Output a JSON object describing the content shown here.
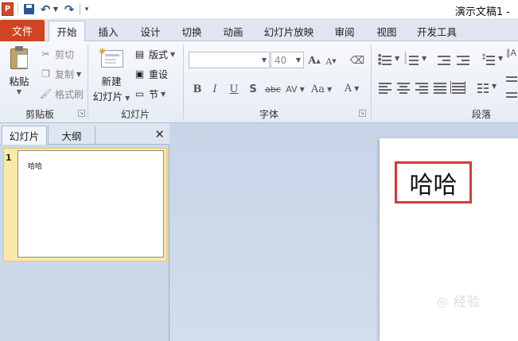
{
  "app": {
    "logo_letter": "P",
    "window_title": "演示文稿1 -"
  },
  "tabs": {
    "file": "文件",
    "items": [
      "开始",
      "插入",
      "设计",
      "切换",
      "动画",
      "幻灯片放映",
      "审阅",
      "视图",
      "开发工具"
    ],
    "active": "开始"
  },
  "ribbon": {
    "clipboard": {
      "paste": "粘贴",
      "cut": "剪切",
      "copy": "复制",
      "format_painter": "格式刷",
      "label": "剪贴板"
    },
    "slides": {
      "new_slide_line1": "新建",
      "new_slide_line2": "幻灯片",
      "layout": "版式",
      "reset": "重设",
      "section": "节",
      "label": "幻灯片"
    },
    "font": {
      "font_name": "",
      "font_size": "40",
      "grow_font": "A",
      "shrink_font": "A",
      "bold": "B",
      "italic": "I",
      "underline": "U",
      "shadow": "S",
      "strikethrough": "abc",
      "char_spacing": "AV",
      "change_case": "Aa",
      "font_color": "A",
      "label": "字体"
    },
    "paragraph": {
      "label": "段落"
    }
  },
  "left_panel": {
    "tab_slides": "幻灯片",
    "tab_outline": "大纲",
    "close": "✕",
    "slide_number": "1",
    "thumbnail_text": "哈哈"
  },
  "slide": {
    "text": "哈哈",
    "watermark": "◎ 经验"
  },
  "colors": {
    "file_tab": "#d04423",
    "highlight_border": "#d9383c",
    "thumb_selected": "#fbe9a8"
  }
}
